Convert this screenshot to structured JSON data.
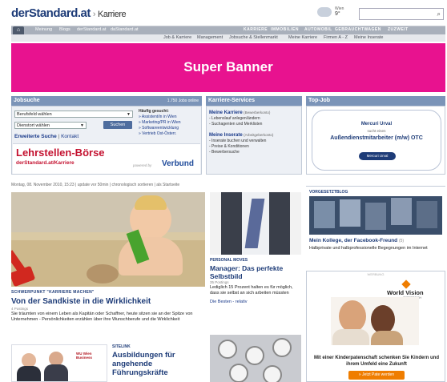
{
  "header": {
    "logo": "derStandard.at",
    "separator": "›",
    "section": "Karriere",
    "weather_city": "Wien",
    "weather_temp": "9°",
    "search_icon": "search-icon"
  },
  "nav": {
    "home_icon": "home-icon",
    "top": [
      "Meinung",
      "Blogs",
      "derStandard.at",
      "daStandard.at"
    ],
    "top_right": [
      "KARRIERE",
      "IMMOBILIEN",
      "AUTOMOBIL",
      "GEBRAUCHTWAGEN",
      "ZUZWEIT"
    ],
    "sub": [
      "Job & Karriere",
      "Management",
      "Jobsuche & Stellenmarkt",
      "Meine Karriere",
      "Firmen A - Z",
      "Meine Inserate"
    ]
  },
  "banner": {
    "label": "Super Banner",
    "color": "#e8128f"
  },
  "jobsuche": {
    "title": "Jobsuche",
    "count": "1.750 Jobs online",
    "select1": "Berufsfeld wählen",
    "select2": "Dienstort wählen",
    "button": "Suchen",
    "frequent_title": "Häufig gesucht:",
    "frequent": [
      "» Assistent/in in Wien",
      "» Marketing/PR in Wien",
      "» Softwareentwicklung",
      "» Vertrieb Ost-Österr."
    ],
    "ext_search": "Erweiterte Suche",
    "pipe": "|",
    "contact": "Kontakt",
    "lehr_title": "Lehrstellen-Börse",
    "lehr_link": "derStandard.at/Karriere",
    "powered": "powered by",
    "verbund": "Verbund"
  },
  "services": {
    "title": "Karriere-Services",
    "mk_title": "Meine Karriere",
    "mk_sub": "(Bewerberkonto)",
    "mk_items": [
      "- Lebenslauf anlegen/ändern",
      "- Suchagenten und Merklisten"
    ],
    "mi_title": "Meine Inserate",
    "mi_sub": "(Arbeitgeberkonto)",
    "mi_items": [
      "- Inserate buchen und verwalten",
      "- Preise & Konditionen",
      "- Bewerbersuche"
    ]
  },
  "topjob": {
    "title": "Top-Job",
    "company": "Mercuri Urval",
    "sucht": "sucht einen",
    "position": "Außendienstmitarbeiter (m/w) OTC",
    "badge": "Mercuri Urval"
  },
  "dateline": "Montag, 08. November 2010, 15:23 | update vor 50min | chronologisch sortieren | als Startseite",
  "main_story": {
    "kicker": "SCHWERPUNKT \"KARRIERE MACHEN\"",
    "title": "Von der Sandkiste in die Wirklichkeit",
    "postings": "4 Postings",
    "text": "Sie träumten von einem Leben als Kapitän oder Schaffner, heute sitzen sie an der Spitze von Unternehmen - Persönlichkeiten erzählen über ihre Wunschberufe und die Wirklichkeit"
  },
  "second_story": {
    "kicker": "PERSONAL MOVES",
    "title": "Manager: Das perfekte Selbstbild",
    "postings": "35 Postings",
    "text": "Lediglich 15 Prozent halten es für möglich, dass sie selbst an sich arbeiten müssten",
    "link": "Die Besten - relativ"
  },
  "blog": {
    "kicker": "VORGESETZTBLOG",
    "title": "Mein Kollege, der Facebook-Freund",
    "count": "(5)",
    "text": "Halbprivate und halbprofessionelle Begegnungen im Internet"
  },
  "ad": {
    "label": "WERBUNG",
    "brand": "World Vision",
    "brand_sub": "ÖSTERREICH",
    "text": "Mit einer Kinderpatenschaft schenken Sie Kindern und ihrem Umfeld eine Zukunft",
    "button": "» Jetzt Pate werden"
  },
  "sitelink": {
    "kicker": "SITELINK",
    "title": "Ausbildungen für angehende Führungskräfte",
    "logo": "WU Wien Business"
  }
}
